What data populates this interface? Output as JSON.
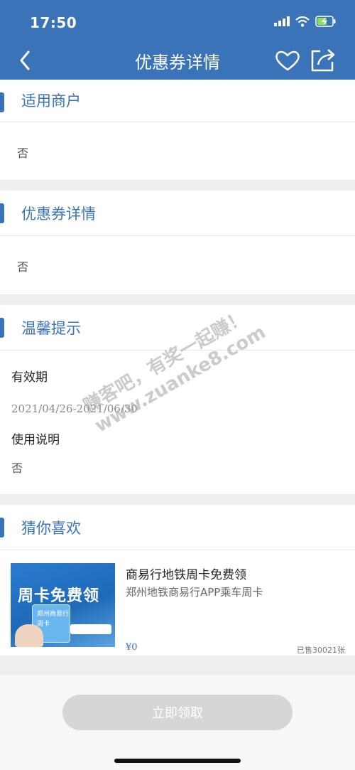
{
  "status_bar": {
    "time": "17:50"
  },
  "nav": {
    "title": "优惠券详情"
  },
  "sections": {
    "merchant": {
      "title": "适用商户",
      "value": "否"
    },
    "coupon": {
      "title": "优惠券详情",
      "value": "否"
    },
    "tips": {
      "title": "温馨提示",
      "validity_label": "有效期",
      "validity_value": "2021/04/26-2021/06/30",
      "usage_label": "使用说明",
      "usage_value": "否"
    },
    "recommend": {
      "title": "猜你喜欢",
      "item": {
        "name": "商易行地铁周卡免费领",
        "desc": "郑州地铁商易行APP乘车周卡",
        "price": "¥0",
        "sold": "已售30021张",
        "thumb_title": "周卡免费领",
        "thumb_card": "郑州商易行 周卡"
      }
    }
  },
  "bottom": {
    "claim_label": "立即领取"
  },
  "watermark": {
    "line1": "赚客吧，有奖一起赚！",
    "line2": "www.zuanke8.com"
  },
  "colors": {
    "brand": "#3b73b9",
    "button_disabled": "#d6d6d6"
  }
}
